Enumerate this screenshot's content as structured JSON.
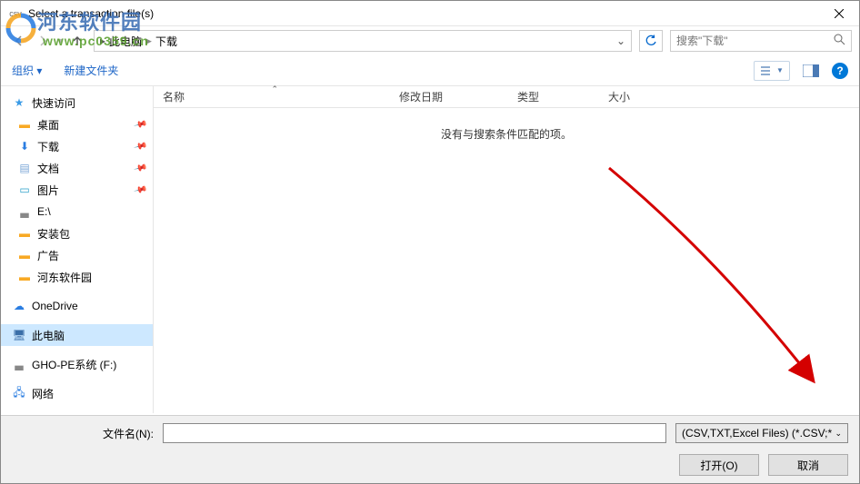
{
  "titlebar": {
    "title": "Select a transaction file(s)",
    "icon_label": "csv"
  },
  "navbar": {
    "breadcrumb": {
      "root": "此电脑",
      "current": "下载"
    },
    "search_placeholder": "搜索\"下载\""
  },
  "toolbar": {
    "organize": "组织 ▾",
    "new_folder": "新建文件夹"
  },
  "sidebar": {
    "quick_access": "快速访问",
    "desktop": "桌面",
    "downloads": "下载",
    "documents": "文档",
    "pictures": "图片",
    "drive_e": "E:\\",
    "install_pkg": "安装包",
    "ads": "广告",
    "hedong": "河东软件园",
    "onedrive": "OneDrive",
    "this_pc": "此电脑",
    "gho_drive": "GHO-PE系统 (F:)",
    "network": "网络"
  },
  "columns": {
    "name": "名称",
    "date": "修改日期",
    "type": "类型",
    "size": "大小"
  },
  "content": {
    "empty": "没有与搜索条件匹配的项。"
  },
  "bottom": {
    "filename_label": "文件名(N):",
    "filter": "(CSV,TXT,Excel Files) (*.CSV;*",
    "open": "打开(O)",
    "cancel": "取消"
  },
  "watermark": {
    "name": "河东软件园",
    "url": "www.pc0359.cn"
  },
  "colors": {
    "accent": "#0078d7",
    "link": "#1e66c7",
    "selected": "#cde8ff",
    "arrow": "#d40000"
  }
}
